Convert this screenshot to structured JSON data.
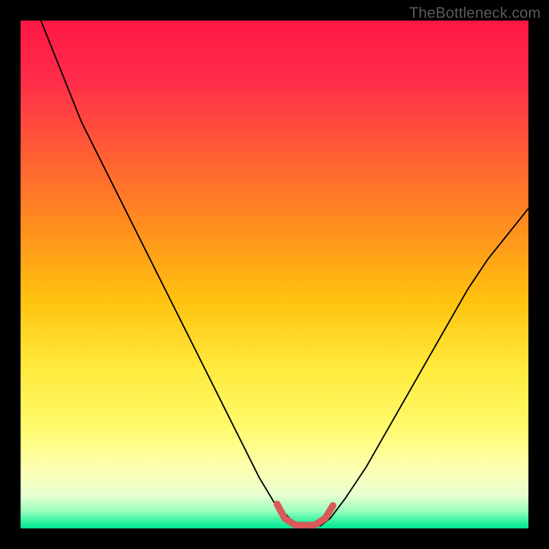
{
  "watermark": "TheBottleneck.com",
  "chart_data": {
    "type": "line",
    "title": "",
    "xlabel": "",
    "ylabel": "",
    "xlim": [
      0,
      100
    ],
    "ylim": [
      0,
      100
    ],
    "grid": false,
    "gradient_stops": [
      {
        "offset": 0,
        "color": "#ff1744"
      },
      {
        "offset": 0.12,
        "color": "#ff2d4a"
      },
      {
        "offset": 0.25,
        "color": "#ff5a36"
      },
      {
        "offset": 0.4,
        "color": "#ff8c1f"
      },
      {
        "offset": 0.55,
        "color": "#ffc20e"
      },
      {
        "offset": 0.68,
        "color": "#ffe93b"
      },
      {
        "offset": 0.8,
        "color": "#fffb6b"
      },
      {
        "offset": 0.88,
        "color": "#fdffb0"
      },
      {
        "offset": 0.935,
        "color": "#e8ffd0"
      },
      {
        "offset": 0.965,
        "color": "#9cffc0"
      },
      {
        "offset": 0.985,
        "color": "#37f3a2"
      },
      {
        "offset": 1.0,
        "color": "#00e893"
      }
    ],
    "curve": {
      "x": [
        4,
        8,
        12,
        17,
        22,
        27,
        32,
        37,
        42,
        47,
        50,
        53,
        55,
        57,
        59,
        61,
        64,
        68,
        72,
        76,
        80,
        84,
        88,
        92,
        96,
        100
      ],
      "y": [
        100,
        90,
        80,
        70,
        60,
        50,
        40,
        30,
        20,
        10,
        5,
        2,
        0.5,
        0.5,
        0.5,
        2,
        6,
        12,
        19,
        26,
        33,
        40,
        47,
        53,
        58,
        63
      ],
      "stroke": "#000000",
      "stroke_width": 2
    },
    "optimal_segment": {
      "x": [
        50.5,
        52,
        54,
        56,
        58,
        60,
        61.5
      ],
      "y": [
        4.8,
        2.0,
        0.7,
        0.6,
        0.7,
        2.0,
        4.5
      ],
      "stroke": "#d85a5a",
      "stroke_width": 10,
      "linecap": "round"
    }
  }
}
